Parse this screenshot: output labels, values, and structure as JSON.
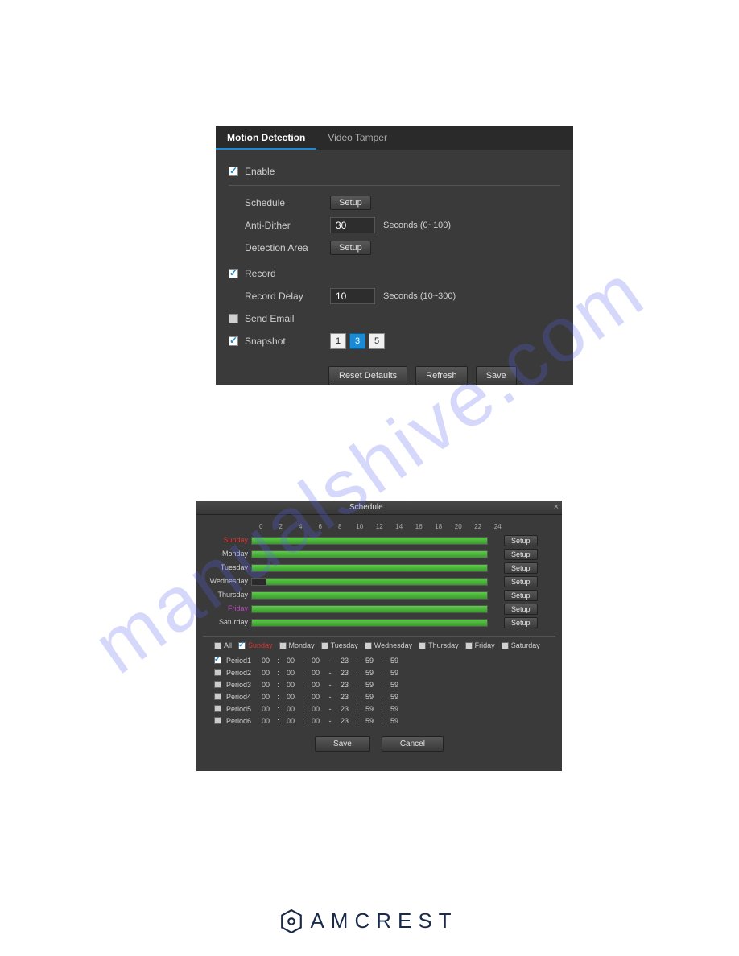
{
  "watermark": "manualshive.com",
  "logo_text": "AMCREST",
  "panel1": {
    "tabs": {
      "motion": "Motion Detection",
      "tamper": "Video Tamper"
    },
    "enable": "Enable",
    "schedule": {
      "label": "Schedule",
      "btn": "Setup"
    },
    "anti_dither": {
      "label": "Anti-Dither",
      "value": "30",
      "hint": "Seconds (0~100)"
    },
    "detect_area": {
      "label": "Detection Area",
      "btn": "Setup"
    },
    "record": "Record",
    "record_delay": {
      "label": "Record Delay",
      "value": "10",
      "hint": "Seconds (10~300)"
    },
    "send_email": "Send Email",
    "snapshot": "Snapshot",
    "channels": [
      "1",
      "3",
      "5"
    ],
    "btns": {
      "reset": "Reset Defaults",
      "refresh": "Refresh",
      "save": "Save"
    }
  },
  "panel2": {
    "title": "Schedule",
    "hours": [
      "0",
      "2",
      "4",
      "6",
      "8",
      "10",
      "12",
      "14",
      "16",
      "18",
      "20",
      "22",
      "24"
    ],
    "days": [
      "Sunday",
      "Monday",
      "Tuesday",
      "Wednesday",
      "Thursday",
      "Friday",
      "Saturday"
    ],
    "setup": "Setup",
    "checks": {
      "all": "All",
      "sunday": "Sunday",
      "monday": "Monday",
      "tuesday": "Tuesday",
      "wednesday": "Wednesday",
      "thursday": "Thursday",
      "friday": "Friday",
      "saturday": "Saturday"
    },
    "periods": [
      {
        "name": "Period1",
        "checked": true,
        "from": [
          "00",
          "00",
          "00"
        ],
        "to": [
          "23",
          "59",
          "59"
        ]
      },
      {
        "name": "Period2",
        "checked": false,
        "from": [
          "00",
          "00",
          "00"
        ],
        "to": [
          "23",
          "59",
          "59"
        ]
      },
      {
        "name": "Period3",
        "checked": false,
        "from": [
          "00",
          "00",
          "00"
        ],
        "to": [
          "23",
          "59",
          "59"
        ]
      },
      {
        "name": "Period4",
        "checked": false,
        "from": [
          "00",
          "00",
          "00"
        ],
        "to": [
          "23",
          "59",
          "59"
        ]
      },
      {
        "name": "Period5",
        "checked": false,
        "from": [
          "00",
          "00",
          "00"
        ],
        "to": [
          "23",
          "59",
          "59"
        ]
      },
      {
        "name": "Period6",
        "checked": false,
        "from": [
          "00",
          "00",
          "00"
        ],
        "to": [
          "23",
          "59",
          "59"
        ]
      }
    ],
    "btns": {
      "save": "Save",
      "cancel": "Cancel"
    }
  }
}
